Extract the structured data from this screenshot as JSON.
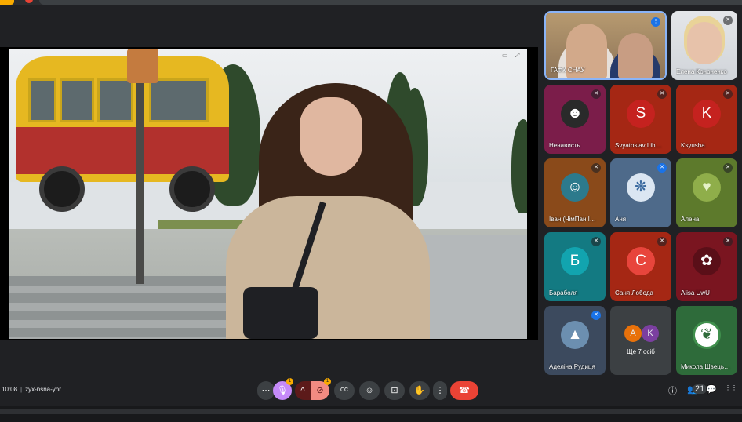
{
  "meeting": {
    "time": "10:08",
    "separator": "|",
    "code": "zyx-nsna-ynr"
  },
  "tiles": [
    {
      "name": "ГАФК СНАУ",
      "type": "video"
    },
    {
      "name": "Елена Кононенко",
      "type": "video"
    },
    {
      "name": "Ненависть",
      "type": "avatar-image",
      "bg": "#7b1d4a"
    },
    {
      "name": "Svyatoslav Lih…",
      "type": "letter",
      "letter": "S",
      "bg": "#a52714",
      "circle": "#c5221f"
    },
    {
      "name": "Ksyusha",
      "type": "letter",
      "letter": "K",
      "bg": "#a52714",
      "circle": "#c5221f"
    },
    {
      "name": "Іван (ЧімПан І…",
      "type": "avatar-image",
      "bg": "#8a4a1a"
    },
    {
      "name": "Аня",
      "type": "avatar-image",
      "bg": "#4e6a8a"
    },
    {
      "name": "Алена",
      "type": "avatar-image",
      "bg": "#5d7a2c"
    },
    {
      "name": "Бараболя",
      "type": "letter",
      "letter": "Б",
      "bg": "#137a82",
      "circle": "#12a4af"
    },
    {
      "name": "Саня Лобода",
      "type": "letter",
      "letter": "С",
      "bg": "#a52714",
      "circle": "#e8453c"
    },
    {
      "name": "Alisa UwU",
      "type": "avatar-image",
      "bg": "#7a1520"
    },
    {
      "name": "Аделіна Рудиця",
      "type": "avatar-image",
      "bg": "#3c4a5e"
    },
    {
      "name": "Ще 7 осіб",
      "type": "others",
      "letters": [
        "А",
        "K"
      ],
      "colors": [
        "#e8710a",
        "#7b3fa0"
      ],
      "bg": "#3c4043"
    },
    {
      "name": "Микола Швець…",
      "type": "avatar-image",
      "bg": "#2e6b3a"
    }
  ],
  "controls": {
    "more_left": "⋯",
    "mic_badge": "1",
    "cam_badge": "1",
    "people_count": "21"
  },
  "icons": {
    "mic": "🎙",
    "caret": "^",
    "camera_off": "⊘",
    "captions": "CC",
    "emoji": "☺",
    "present": "⊡",
    "hand": "✋",
    "more": "⋮",
    "hangup": "☎",
    "info": "ⓘ",
    "people": "👥",
    "chat": "💬",
    "activities": "⋮⋮"
  },
  "colors": {
    "background": "#202124",
    "hangup": "#ea4335",
    "accent_badge": "#f9ab00"
  }
}
